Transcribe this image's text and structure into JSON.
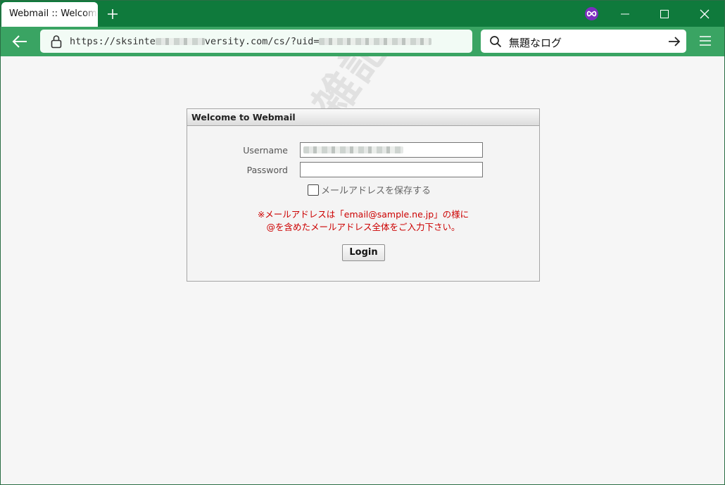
{
  "browser": {
    "tab_title": "Webmail :: Welcome to Webmail",
    "new_tab_icon": "plus-icon",
    "extension_icon": "infinity-icon",
    "window_controls": [
      "minimize-icon",
      "maximize-icon",
      "close-icon"
    ],
    "url_prefix": "https://sksinte",
    "url_middle": "versity.com/cs/?uid=",
    "search_value": "無題なログ",
    "accent_color": "#0f7a3c",
    "navbar_color": "#3aa463"
  },
  "watermark": "無題な雑記ログ",
  "login": {
    "header": "Welcome to Webmail",
    "username_label": "Username",
    "password_label": "Password",
    "username_value": "",
    "password_value": "",
    "remember_label": "メールアドレスを保存する",
    "remember_checked": false,
    "notice_line1": "※メールアドレスは「email@sample.ne.jp」の様に",
    "notice_line2": "@を含めたメールアドレス全体をご入力下さい。",
    "notice_color": "#cc0000",
    "login_button": "Login"
  }
}
